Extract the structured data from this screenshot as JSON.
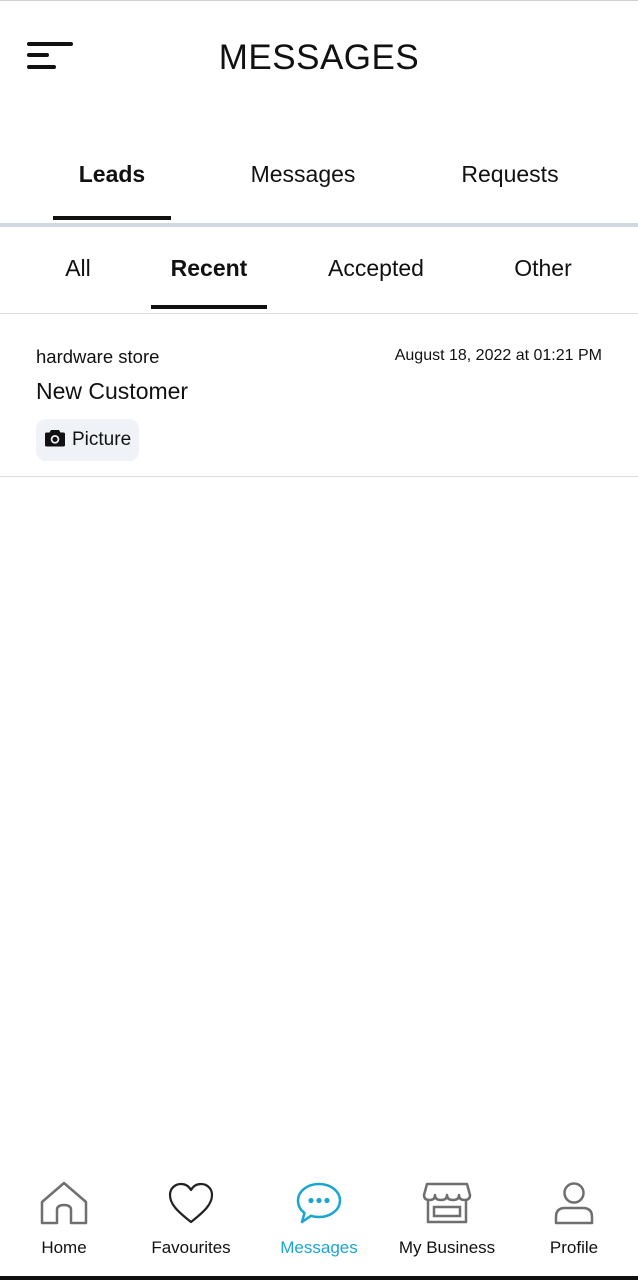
{
  "header": {
    "title": "MESSAGES",
    "menu_icon": "menu-icon"
  },
  "main_tabs": [
    {
      "label": "Leads",
      "active": true
    },
    {
      "label": "Messages",
      "active": false
    },
    {
      "label": "Requests",
      "active": false
    }
  ],
  "sub_tabs": [
    {
      "label": "All",
      "active": false
    },
    {
      "label": "Recent",
      "active": true
    },
    {
      "label": "Accepted",
      "active": false
    },
    {
      "label": "Other",
      "active": false
    }
  ],
  "leads": [
    {
      "sender": "hardware store",
      "date": "August 18, 2022 at 01:21 PM",
      "title": "New Customer",
      "attachment": {
        "icon": "camera-icon",
        "label": "Picture"
      }
    }
  ],
  "bottom_nav": [
    {
      "label": "Home",
      "icon": "home-icon",
      "active": false
    },
    {
      "label": "Favourites",
      "icon": "heart-icon",
      "active": false
    },
    {
      "label": "Messages",
      "icon": "chat-bubble-icon",
      "active": true
    },
    {
      "label": "My Business",
      "icon": "storefront-icon",
      "active": false
    },
    {
      "label": "Profile",
      "icon": "user-icon",
      "active": false
    }
  ],
  "colors": {
    "accent": "#1aa6d3",
    "text": "#111111",
    "icon_inactive": "#6f6f6f",
    "attachment_bg": "#eff3f8",
    "divider": "#d3d9e0"
  }
}
